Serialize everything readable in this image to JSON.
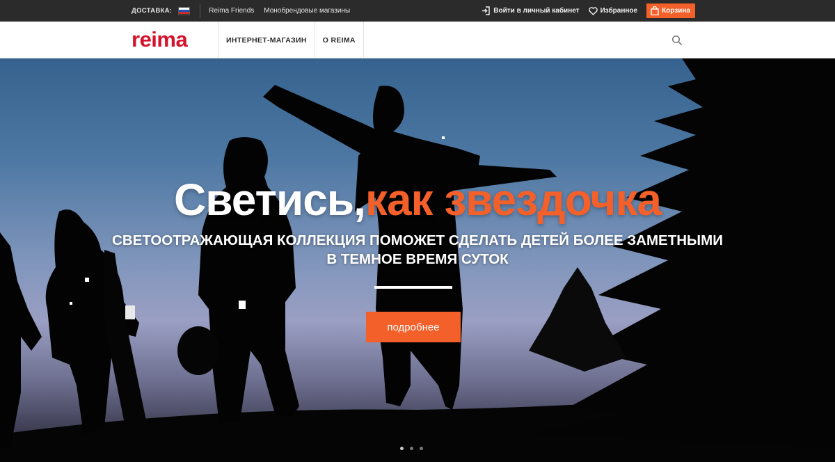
{
  "topbar": {
    "delivery_label": "ДОСТАВКА:",
    "links": [
      "Reima Friends",
      "Монобрендовые магазины"
    ],
    "login": "Войти в личный кабинет",
    "favorites": "Избранное",
    "cart": "Корзина"
  },
  "nav": {
    "logo": "reima",
    "items": [
      "ИНТЕРНЕТ-МАГАЗИН",
      "О REIMA"
    ]
  },
  "hero": {
    "title_white": "Светись,",
    "title_accent": "как звездочка",
    "subtitle": "Светоотражающая коллекция поможет сделать детей более заметными в темное время суток",
    "cta": "подробнее",
    "slides_total": 3,
    "active_slide": 1
  },
  "colors": {
    "accent": "#f4602a",
    "brand": "#d4122b",
    "topbar_bg": "#2b2b2b"
  },
  "icons": [
    "flag-russia-icon",
    "login-icon",
    "heart-icon",
    "bag-icon",
    "search-icon"
  ]
}
